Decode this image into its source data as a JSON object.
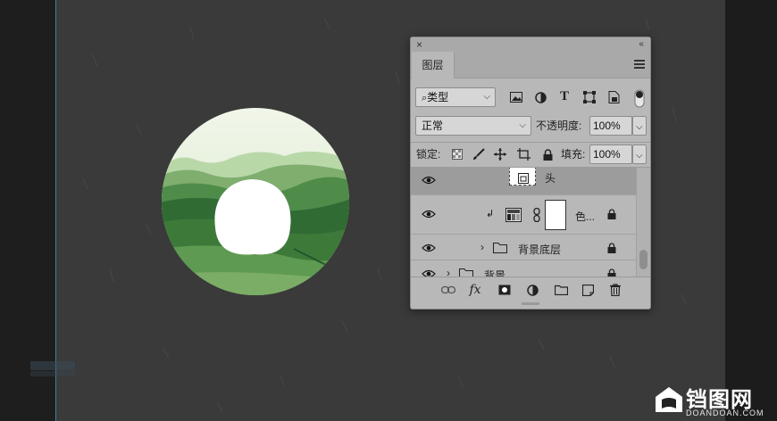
{
  "panel": {
    "close_glyph": "×",
    "collapse_glyph": "‹‹",
    "tab_label": "图层",
    "filter": {
      "label": "类型",
      "icons": [
        "image-filter-icon",
        "adjustment-filter-icon",
        "type-filter-icon",
        "shape-filter-icon",
        "smartobject-filter-icon",
        "filter-toggle-icon"
      ]
    },
    "blend_mode": "正常",
    "opacity_label": "不透明度:",
    "opacity_value": "100%",
    "lock_label": "锁定:",
    "lock_icons": [
      "lock-transparent-pixels-icon",
      "lock-image-pixels-icon",
      "lock-position-icon",
      "lock-artboard-icon",
      "lock-all-icon"
    ],
    "fill_label": "填充:",
    "fill_value": "100%",
    "layers": [
      {
        "name": "头",
        "kind": "smart-object",
        "selected": true,
        "visible": true
      },
      {
        "name": "色...",
        "kind": "adjustment-with-mask",
        "selected": false,
        "visible": true,
        "locked": true
      },
      {
        "name": "背景底层",
        "kind": "group",
        "selected": false,
        "visible": true,
        "locked": true
      },
      {
        "name": "背景",
        "kind": "group",
        "selected": false,
        "visible": true,
        "locked": true
      }
    ],
    "bottom_icons": [
      "link-layers-icon",
      "fx-icon",
      "add-mask-icon",
      "adjustment-layer-icon",
      "new-group-icon",
      "new-layer-icon",
      "delete-layer-icon"
    ],
    "fx_label": "fx"
  },
  "watermark": {
    "title": "铛图网",
    "subtitle": "DOANDOAN.COM"
  },
  "colors": {
    "canvas": "#3a3a3a",
    "panel_bg": "#b8b8b8",
    "selected_layer": "#9c9c9c",
    "guide": "#3fa7c9"
  }
}
